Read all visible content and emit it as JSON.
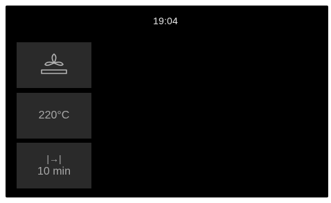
{
  "status": {
    "time": "19:04"
  },
  "tiles": {
    "mode": {
      "icon": "fan-top-heat-icon"
    },
    "temperature": {
      "value": "220°C"
    },
    "timer": {
      "icon": "skip-to-end-icon",
      "glyph": "|→|",
      "value": "10 min"
    }
  },
  "colors": {
    "screen_bg": "#000000",
    "tile_bg": "#2a2a2a",
    "text": "#a8a8a8",
    "clock": "#e6e6e6"
  }
}
